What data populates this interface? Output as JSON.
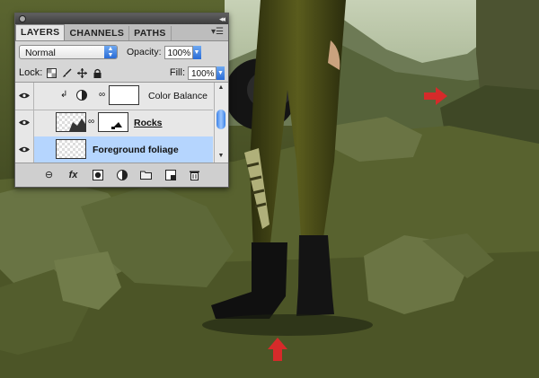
{
  "panel": {
    "tabs": [
      {
        "label": "LAYERS",
        "active": true
      },
      {
        "label": "CHANNELS",
        "active": false
      },
      {
        "label": "PATHS",
        "active": false
      }
    ],
    "blend_mode": "Normal",
    "opacity_label": "Opacity:",
    "opacity_value": "100%",
    "lock_label": "Lock:",
    "fill_label": "Fill:",
    "fill_value": "100%",
    "layers": [
      {
        "name": "Color Balance",
        "type": "adjustment",
        "clipped": true,
        "selected": false
      },
      {
        "name": "Rocks",
        "type": "layer-with-mask",
        "selected": false
      },
      {
        "name": "Foreground foliage",
        "type": "layer",
        "selected": true
      }
    ],
    "footer_icons": [
      "link-icon",
      "fx-icon",
      "mask-icon",
      "adjustment-icon",
      "folder-icon",
      "new-layer-icon",
      "trash-icon"
    ]
  },
  "markers": [
    {
      "name": "red-arrow-right",
      "color": "#d62a2a",
      "direction": "right"
    },
    {
      "name": "red-arrow-up",
      "color": "#d62a2a",
      "direction": "up"
    }
  ]
}
